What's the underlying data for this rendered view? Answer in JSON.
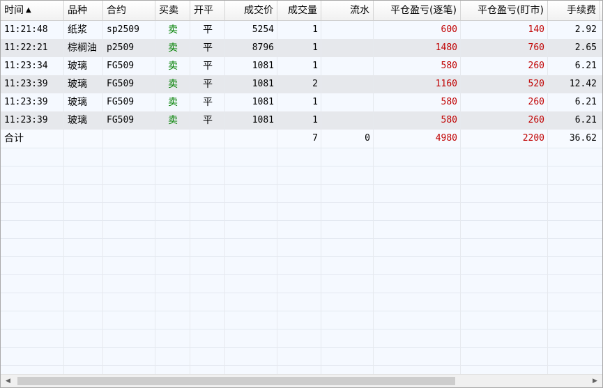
{
  "columns": [
    {
      "id": "time",
      "label": "时间",
      "sort_icon": "▲"
    },
    {
      "id": "variety",
      "label": "品种"
    },
    {
      "id": "contract",
      "label": "合约"
    },
    {
      "id": "side",
      "label": "买卖"
    },
    {
      "id": "openclose",
      "label": "开平"
    },
    {
      "id": "price",
      "label": "成交价"
    },
    {
      "id": "volume",
      "label": "成交量"
    },
    {
      "id": "flow",
      "label": "流水"
    },
    {
      "id": "pnl_trade",
      "label": "平仓盈亏(逐笔)"
    },
    {
      "id": "pnl_mtm",
      "label": "平仓盈亏(盯市)"
    },
    {
      "id": "fee",
      "label": "手续费"
    }
  ],
  "rows": [
    {
      "time": "11:21:48",
      "variety": "纸浆",
      "contract": "sp2509",
      "side": "卖",
      "openclose": "平",
      "price": "5254",
      "volume": "1",
      "flow": "",
      "pnl_trade": "600",
      "pnl_mtm": "140",
      "fee": "2.92"
    },
    {
      "time": "11:22:21",
      "variety": "棕榈油",
      "contract": "p2509",
      "side": "卖",
      "openclose": "平",
      "price": "8796",
      "volume": "1",
      "flow": "",
      "pnl_trade": "1480",
      "pnl_mtm": "760",
      "fee": "2.65"
    },
    {
      "time": "11:23:34",
      "variety": "玻璃",
      "contract": "FG509",
      "side": "卖",
      "openclose": "平",
      "price": "1081",
      "volume": "1",
      "flow": "",
      "pnl_trade": "580",
      "pnl_mtm": "260",
      "fee": "6.21"
    },
    {
      "time": "11:23:39",
      "variety": "玻璃",
      "contract": "FG509",
      "side": "卖",
      "openclose": "平",
      "price": "1081",
      "volume": "2",
      "flow": "",
      "pnl_trade": "1160",
      "pnl_mtm": "520",
      "fee": "12.42"
    },
    {
      "time": "11:23:39",
      "variety": "玻璃",
      "contract": "FG509",
      "side": "卖",
      "openclose": "平",
      "price": "1081",
      "volume": "1",
      "flow": "",
      "pnl_trade": "580",
      "pnl_mtm": "260",
      "fee": "6.21"
    },
    {
      "time": "11:23:39",
      "variety": "玻璃",
      "contract": "FG509",
      "side": "卖",
      "openclose": "平",
      "price": "1081",
      "volume": "1",
      "flow": "",
      "pnl_trade": "580",
      "pnl_mtm": "260",
      "fee": "6.21"
    }
  ],
  "total": {
    "label": "合计",
    "volume": "7",
    "flow": "0",
    "pnl_trade": "4980",
    "pnl_mtm": "2200",
    "fee": "36.62"
  },
  "scrollbar": {
    "left_arrow": "◀",
    "right_arrow": "▶"
  },
  "colors": {
    "sell": "#008000",
    "profit": "#c00000",
    "header_bg": "#f4f4f4",
    "alt_row": "#e6e8ec",
    "grid_bg": "#f5f9ff"
  }
}
